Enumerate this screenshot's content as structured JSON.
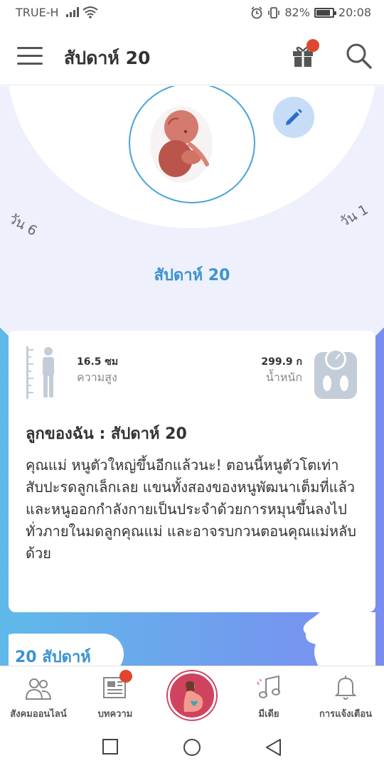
{
  "status_bar": {
    "carrier": "TRUE-H",
    "battery": "82%",
    "time": "20:08",
    "icons": [
      "signal-icon",
      "wifi-icon",
      "alarm-icon",
      "vibrate-icon",
      "battery-icon"
    ]
  },
  "app_bar": {
    "title": "สัปดาห์ 20",
    "icons": [
      "menu-icon",
      "gift-icon",
      "search-icon"
    ]
  },
  "hero": {
    "day_left": "วัน 6",
    "day_right": "วัน 1",
    "week_label": "สัปดาห์ 20"
  },
  "stats": {
    "height_value": "16.5 ซม",
    "height_label": "ความสูง",
    "weight_value": "299.9 ก",
    "weight_label": "น้ำหนัก"
  },
  "card": {
    "title": "ลูกของฉัน :  สัปดาห์ 20",
    "text": "คุณแม่ หนูตัวใหญ่ขึ้นอีกแล้วนะ! ตอนนี้หนูตัวโตเท่าสับปะรดลูกเล็กเลย แขนทั้งสองของหนูพัฒนาเต็มที่แล้ว และหนูออกกำลังกายเป็นประจำด้วยการหมุนขึ้นลงไปทั่วภายในมดลูกคุณแม่ และอาจรบกวนตอนคุณแม่หลับด้วย"
  },
  "next_card": {
    "label": "20 สัปดาห์"
  },
  "bottom_nav": [
    {
      "label": "สังคมออนไลน์",
      "icon": "community-icon"
    },
    {
      "label": "บทความ",
      "icon": "article-icon"
    },
    {
      "label": "",
      "icon": "pregnancy-icon"
    },
    {
      "label": "มีเดีย",
      "icon": "music-icon"
    },
    {
      "label": "การแจ้งเตือน",
      "icon": "bell-icon"
    }
  ],
  "colors": {
    "accent_blue": "#3b93d1",
    "gradient_start": "#5fb9e9",
    "gradient_end": "#7b8cf1",
    "badge_red": "#e0462f",
    "center_button": "#d0435f"
  }
}
